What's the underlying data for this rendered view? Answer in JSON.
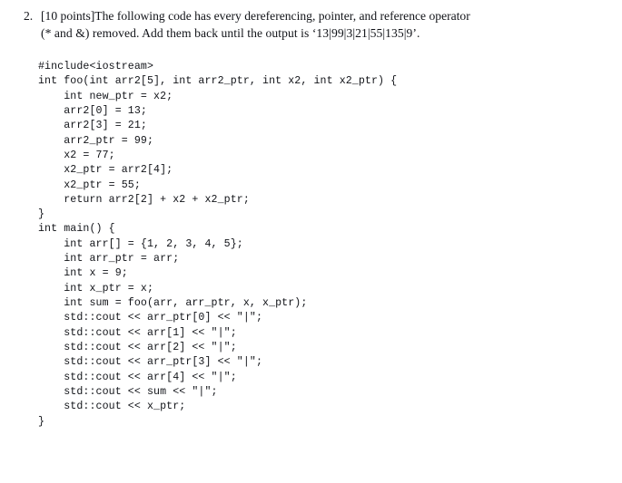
{
  "question": {
    "number": "2.",
    "points_label": "[10 points]",
    "line1": "[10 points]The following code has every dereferencing, pointer, and reference operator",
    "line2": "(* and &) removed.  Add them back until the output is ‘13|99|3|21|55|135|9’.",
    "expected_output": "13|99|3|21|55|135|9"
  },
  "code": {
    "language": "cpp",
    "lines": [
      "#include<iostream>",
      "int foo(int arr2[5], int arr2_ptr, int x2, int x2_ptr) {",
      "    int new_ptr = x2;",
      "    arr2[0] = 13;",
      "    arr2[3] = 21;",
      "    arr2_ptr = 99;",
      "    x2 = 77;",
      "    x2_ptr = arr2[4];",
      "    x2_ptr = 55;",
      "    return arr2[2] + x2 + x2_ptr;",
      "}",
      "int main() {",
      "    int arr[] = {1, 2, 3, 4, 5};",
      "    int arr_ptr = arr;",
      "    int x = 9;",
      "    int x_ptr = x;",
      "    int sum = foo(arr, arr_ptr, x, x_ptr);",
      "    std::cout << arr_ptr[0] << \"|\";",
      "    std::cout << arr[1] << \"|\";",
      "    std::cout << arr[2] << \"|\";",
      "    std::cout << arr_ptr[3] << \"|\";",
      "    std::cout << arr[4] << \"|\";",
      "    std::cout << sum << \"|\";",
      "    std::cout << x_ptr;",
      "}"
    ]
  },
  "colors": {
    "page_background": "#ffffff",
    "text": "#111318"
  }
}
